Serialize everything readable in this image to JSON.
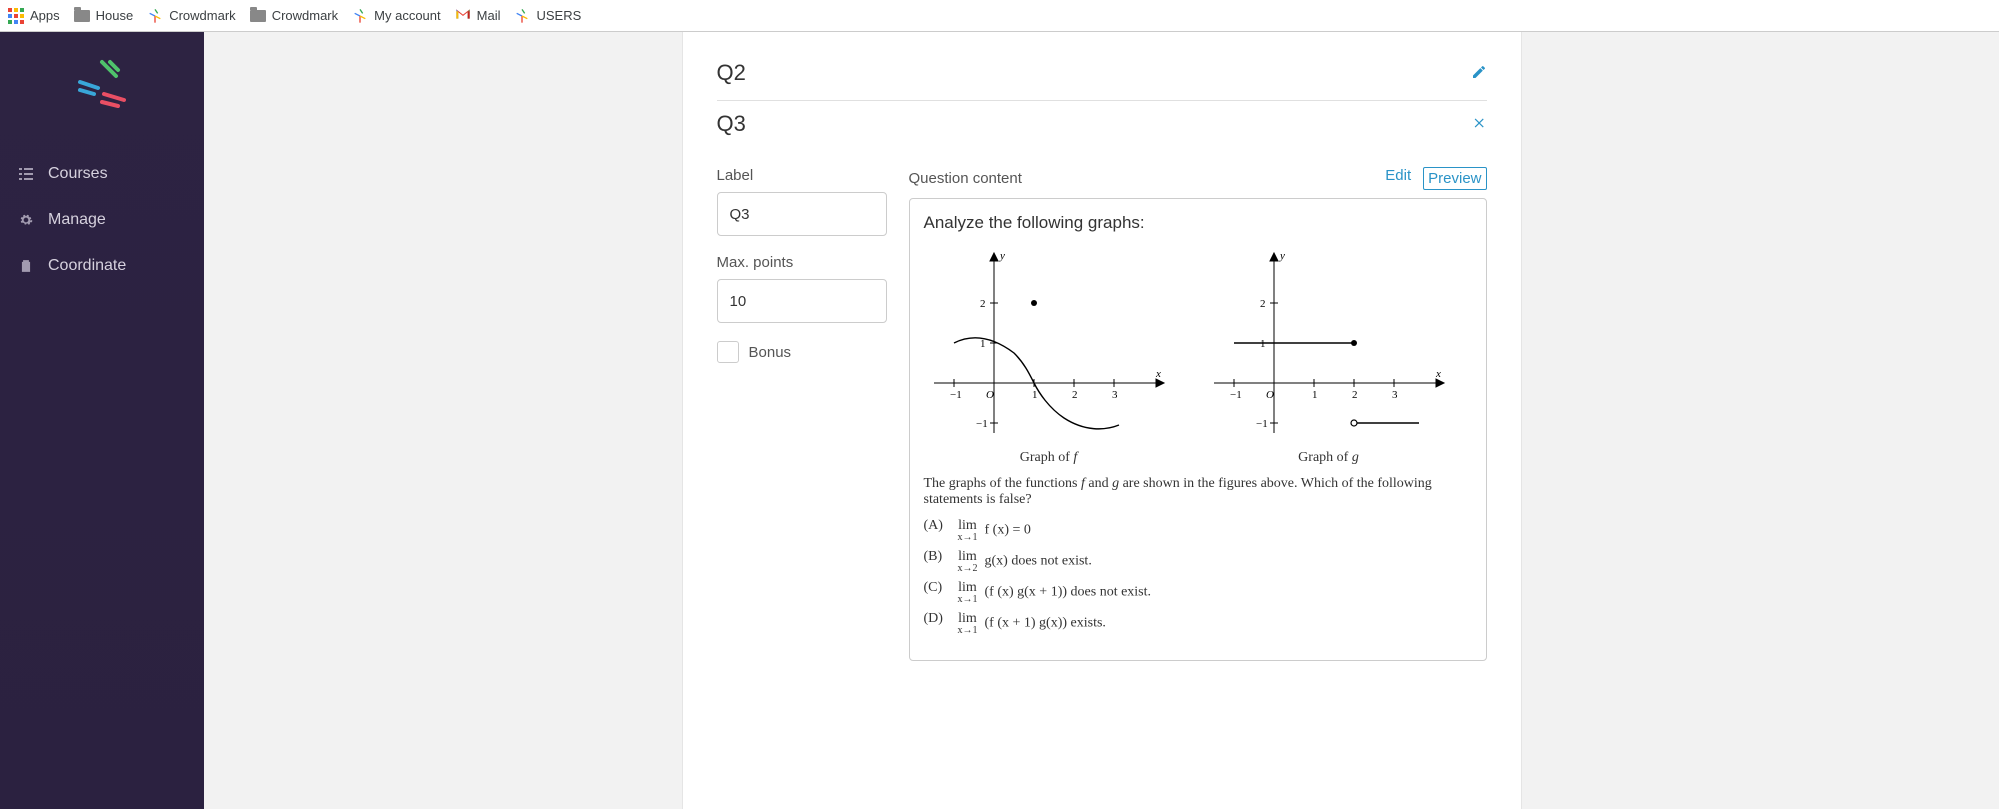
{
  "bookmarks": {
    "apps": "Apps",
    "house": "House",
    "crowdmark1": "Crowdmark",
    "crowdmark2": "Crowdmark",
    "myaccount": "My account",
    "mail": "Mail",
    "users": "USERS"
  },
  "sidebar": {
    "items": [
      {
        "label": "Courses"
      },
      {
        "label": "Manage"
      },
      {
        "label": "Coordinate"
      }
    ]
  },
  "questions": {
    "q2": {
      "title": "Q2"
    },
    "q3": {
      "title": "Q3",
      "label_field": "Label",
      "label_value": "Q3",
      "maxpoints_field": "Max. points",
      "maxpoints_value": "10",
      "bonus_label": "Bonus"
    }
  },
  "content": {
    "header": "Question content",
    "edit": "Edit",
    "preview": "Preview",
    "prompt": "Analyze the following graphs:",
    "caption_f": "Graph of ",
    "caption_f_var": "f",
    "caption_g": "Graph of ",
    "caption_g_var": "g",
    "statement_pre": "The graphs of the functions ",
    "statement_mid": " and ",
    "statement_post": " are shown in the figures above.  Which of the following statements is false?",
    "options": {
      "A": {
        "label": "(A)",
        "expr": "f (x) = 0",
        "lim_sub": "x→1"
      },
      "B": {
        "label": "(B)",
        "expr": "g(x) does not exist.",
        "lim_sub": "x→2"
      },
      "C": {
        "label": "(C)",
        "expr": "(f (x) g(x + 1)) does not exist.",
        "lim_sub": "x→1"
      },
      "D": {
        "label": "(D)",
        "expr": "(f (x + 1) g(x)) exists.",
        "lim_sub": "x→1"
      }
    }
  },
  "chart_data": [
    {
      "type": "line",
      "name": "f",
      "title": "Graph of f",
      "xlabel": "x",
      "ylabel": "y",
      "xlim": [
        -1.5,
        3.5
      ],
      "ylim": [
        -1.5,
        2.5
      ],
      "xticks": [
        -1,
        0,
        1,
        2,
        3
      ],
      "yticks": [
        -1,
        1,
        2
      ],
      "origin_label": "O",
      "series": [
        {
          "name": "f",
          "points": [
            {
              "x": -1.0,
              "y": 1.0
            },
            {
              "x": -0.5,
              "y": 1.05
            },
            {
              "x": 0.0,
              "y": 1.0
            },
            {
              "x": 0.5,
              "y": 0.6
            },
            {
              "x": 1.0,
              "y": 0.0
            },
            {
              "x": 1.5,
              "y": -0.6
            },
            {
              "x": 2.0,
              "y": -1.0
            },
            {
              "x": 2.5,
              "y": -1.05
            },
            {
              "x": 3.0,
              "y": -1.0
            }
          ]
        }
      ],
      "markers": [
        {
          "x": 1.0,
          "y": 2.0,
          "type": "filled"
        }
      ],
      "notes": "f is continuous s-curve passing through (1,0); isolated filled point at (1,2) indicates f(1)=2 (value differs from limit)."
    },
    {
      "type": "line",
      "name": "g",
      "title": "Graph of g",
      "xlabel": "x",
      "ylabel": "y",
      "xlim": [
        -1.5,
        3.5
      ],
      "ylim": [
        -1.5,
        2.5
      ],
      "xticks": [
        -1,
        0,
        1,
        2,
        3
      ],
      "yticks": [
        -1,
        1,
        2
      ],
      "origin_label": "O",
      "series": [
        {
          "name": "g_segment_1",
          "points": [
            {
              "x": -1.0,
              "y": 1.0
            },
            {
              "x": 2.0,
              "y": 1.0
            }
          ],
          "left_end": "closed",
          "right_end": "closed"
        },
        {
          "name": "g_segment_2",
          "points": [
            {
              "x": 2.0,
              "y": -1.0
            },
            {
              "x": 3.5,
              "y": -1.0
            }
          ],
          "left_end": "open",
          "right_end": "arrow"
        }
      ],
      "notes": "g is a step: y=1 on [-1,2] with filled endpoint at x=2, then y=-1 for x>2 with open circle at (2,-1)."
    }
  ]
}
